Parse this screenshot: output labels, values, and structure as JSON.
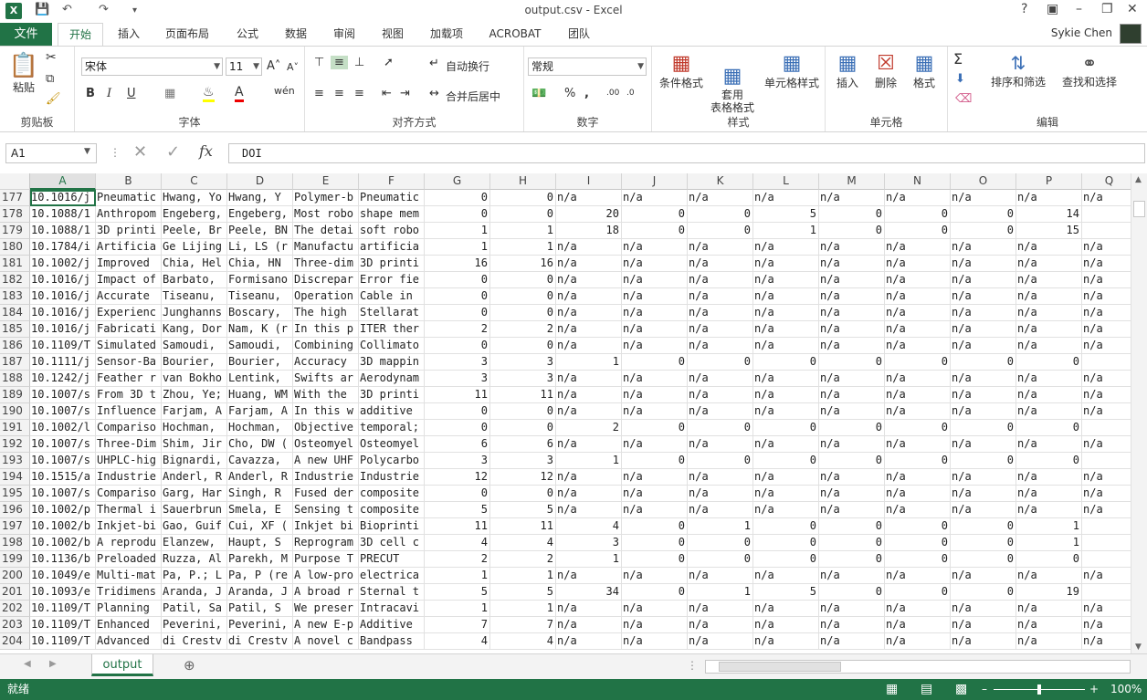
{
  "window": {
    "title": "output.csv - Excel",
    "app_icon": "X"
  },
  "tabs": {
    "file": "文件",
    "items": [
      "开始",
      "插入",
      "页面布局",
      "公式",
      "数据",
      "审阅",
      "视图",
      "加载项",
      "ACROBAT",
      "团队"
    ],
    "active": "开始",
    "user": "Sykie Chen"
  },
  "ribbon": {
    "clipboard": {
      "label": "剪贴板",
      "paste": "粘贴"
    },
    "font": {
      "label": "字体",
      "family": "宋体",
      "size": "11",
      "bold": "B",
      "italic": "I",
      "underline": "U"
    },
    "alignment": {
      "label": "对齐方式",
      "wrap": "自动换行",
      "merge": "合并后居中"
    },
    "number": {
      "label": "数字",
      "format": "常规",
      "percent": "%",
      "comma": ","
    },
    "styles": {
      "label": "样式",
      "conditional": "条件格式",
      "table": "套用\n表格格式",
      "cell": "单元格样式"
    },
    "cells": {
      "label": "单元格",
      "insert": "插入",
      "delete": "删除",
      "format": "格式"
    },
    "editing": {
      "label": "编辑",
      "sort": "排序和筛选",
      "find": "查找和选择"
    }
  },
  "formula_bar": {
    "name_box": "A1",
    "formula": "DOI",
    "fx": "fx"
  },
  "sheet": {
    "columns": [
      "A",
      "B",
      "C",
      "D",
      "E",
      "F",
      "G",
      "H",
      "I",
      "J",
      "K",
      "L",
      "M",
      "N",
      "O",
      "P",
      "Q"
    ],
    "selected_col": "A",
    "rows": [
      {
        "n": "177",
        "c": [
          "10.1016/j",
          "Pneumatic",
          "Hwang, Yo",
          "Hwang, Y",
          "Polymer-b",
          "Pneumatic",
          "0",
          "0",
          "n/a",
          "n/a",
          "n/a",
          "n/a",
          "n/a",
          "n/a",
          "n/a",
          "n/a",
          "n/a"
        ]
      },
      {
        "n": "178",
        "c": [
          "10.1088/1",
          "Anthropom",
          "Engeberg,",
          "Engeberg,",
          "Most robo",
          "shape mem",
          "0",
          "0",
          "20",
          "0",
          "0",
          "5",
          "0",
          "0",
          "0",
          "14",
          ""
        ]
      },
      {
        "n": "179",
        "c": [
          "10.1088/1",
          "3D printi",
          "Peele, Br",
          "Peele, BN",
          "The detai",
          "soft robo",
          "1",
          "1",
          "18",
          "0",
          "0",
          "1",
          "0",
          "0",
          "0",
          "15",
          ""
        ]
      },
      {
        "n": "180",
        "c": [
          "10.1784/i",
          "Artificia",
          "Ge Lijing",
          "Li, LS (r",
          "Manufactu",
          "artificia",
          "1",
          "1",
          "n/a",
          "n/a",
          "n/a",
          "n/a",
          "n/a",
          "n/a",
          "n/a",
          "n/a",
          "n/a"
        ]
      },
      {
        "n": "181",
        "c": [
          "10.1002/j",
          "Improved",
          "Chia, Hel",
          "Chia, HN",
          "Three-dim",
          "3D printi",
          "16",
          "16",
          "n/a",
          "n/a",
          "n/a",
          "n/a",
          "n/a",
          "n/a",
          "n/a",
          "n/a",
          "n/a"
        ]
      },
      {
        "n": "182",
        "c": [
          "10.1016/j",
          "Impact of",
          "Barbato,",
          "Formisano",
          "Discrepar",
          "Error fie",
          "0",
          "0",
          "n/a",
          "n/a",
          "n/a",
          "n/a",
          "n/a",
          "n/a",
          "n/a",
          "n/a",
          "n/a"
        ]
      },
      {
        "n": "183",
        "c": [
          "10.1016/j",
          "Accurate",
          "Tiseanu,",
          "Tiseanu,",
          "Operation",
          "Cable in",
          "0",
          "0",
          "n/a",
          "n/a",
          "n/a",
          "n/a",
          "n/a",
          "n/a",
          "n/a",
          "n/a",
          "n/a"
        ]
      },
      {
        "n": "184",
        "c": [
          "10.1016/j",
          "Experienc",
          "Junghanns",
          "Boscary,",
          "The high",
          "Stellarat",
          "0",
          "0",
          "n/a",
          "n/a",
          "n/a",
          "n/a",
          "n/a",
          "n/a",
          "n/a",
          "n/a",
          "n/a"
        ]
      },
      {
        "n": "185",
        "c": [
          "10.1016/j",
          "Fabricati",
          "Kang, Dor",
          "Nam, K (r",
          "In this p",
          "ITER ther",
          "2",
          "2",
          "n/a",
          "n/a",
          "n/a",
          "n/a",
          "n/a",
          "n/a",
          "n/a",
          "n/a",
          "n/a"
        ]
      },
      {
        "n": "186",
        "c": [
          "10.1109/T",
          "Simulated",
          "Samoudi,",
          "Samoudi,",
          "Combining",
          "Collimato",
          "0",
          "0",
          "n/a",
          "n/a",
          "n/a",
          "n/a",
          "n/a",
          "n/a",
          "n/a",
          "n/a",
          "n/a"
        ]
      },
      {
        "n": "187",
        "c": [
          "10.1111/j",
          "Sensor-Ba",
          "Bourier,",
          "Bourier,",
          "Accuracy",
          "3D mappin",
          "3",
          "3",
          "1",
          "0",
          "0",
          "0",
          "0",
          "0",
          "0",
          "0",
          ""
        ]
      },
      {
        "n": "188",
        "c": [
          "10.1242/j",
          "Feather r",
          "van Bokho",
          "Lentink,",
          "Swifts ar",
          "Aerodynam",
          "3",
          "3",
          "n/a",
          "n/a",
          "n/a",
          "n/a",
          "n/a",
          "n/a",
          "n/a",
          "n/a",
          "n/a"
        ]
      },
      {
        "n": "189",
        "c": [
          "10.1007/s",
          "From 3D t",
          "Zhou, Ye;",
          "Huang, WM",
          "With the",
          "3D printi",
          "11",
          "11",
          "n/a",
          "n/a",
          "n/a",
          "n/a",
          "n/a",
          "n/a",
          "n/a",
          "n/a",
          "n/a"
        ]
      },
      {
        "n": "190",
        "c": [
          "10.1007/s",
          "Influence",
          "Farjam, A",
          "Farjam, A",
          "In this w",
          "additive",
          "0",
          "0",
          "n/a",
          "n/a",
          "n/a",
          "n/a",
          "n/a",
          "n/a",
          "n/a",
          "n/a",
          "n/a"
        ]
      },
      {
        "n": "191",
        "c": [
          "10.1002/l",
          "Compariso",
          "Hochman,",
          "Hochman,",
          "Objective",
          "temporal;",
          "0",
          "0",
          "2",
          "0",
          "0",
          "0",
          "0",
          "0",
          "0",
          "0",
          ""
        ]
      },
      {
        "n": "192",
        "c": [
          "10.1007/s",
          "Three-Dim",
          "Shim, Jir",
          "Cho, DW (",
          "Osteomyel",
          "Osteomyel",
          "6",
          "6",
          "n/a",
          "n/a",
          "n/a",
          "n/a",
          "n/a",
          "n/a",
          "n/a",
          "n/a",
          "n/a"
        ]
      },
      {
        "n": "193",
        "c": [
          "10.1007/s",
          "UHPLC-hig",
          "Bignardi,",
          "Cavazza,",
          "A new UHF",
          "Polycarbo",
          "3",
          "3",
          "1",
          "0",
          "0",
          "0",
          "0",
          "0",
          "0",
          "0",
          ""
        ]
      },
      {
        "n": "194",
        "c": [
          "10.1515/a",
          "Industrie",
          "Anderl, R",
          "Anderl, R",
          "Industrie",
          "Industrie",
          "12",
          "12",
          "n/a",
          "n/a",
          "n/a",
          "n/a",
          "n/a",
          "n/a",
          "n/a",
          "n/a",
          "n/a"
        ]
      },
      {
        "n": "195",
        "c": [
          "10.1007/s",
          "Compariso",
          "Garg, Har",
          "Singh, R",
          "Fused der",
          "composite",
          "0",
          "0",
          "n/a",
          "n/a",
          "n/a",
          "n/a",
          "n/a",
          "n/a",
          "n/a",
          "n/a",
          "n/a"
        ]
      },
      {
        "n": "196",
        "c": [
          "10.1002/p",
          "Thermal i",
          "Sauerbrun",
          "Smela, E",
          "Sensing t",
          "composite",
          "5",
          "5",
          "n/a",
          "n/a",
          "n/a",
          "n/a",
          "n/a",
          "n/a",
          "n/a",
          "n/a",
          "n/a"
        ]
      },
      {
        "n": "197",
        "c": [
          "10.1002/b",
          "Inkjet-bi",
          "Gao, Guif",
          "Cui, XF (",
          "Inkjet bi",
          "Bioprinti",
          "11",
          "11",
          "4",
          "0",
          "1",
          "0",
          "0",
          "0",
          "0",
          "1",
          ""
        ]
      },
      {
        "n": "198",
        "c": [
          "10.1002/b",
          "A reprodu",
          "Elanzew,",
          "Haupt, S",
          "Reprogram",
          "3D cell c",
          "4",
          "4",
          "3",
          "0",
          "0",
          "0",
          "0",
          "0",
          "0",
          "1",
          ""
        ]
      },
      {
        "n": "199",
        "c": [
          "10.1136/b",
          "Preloaded",
          "Ruzza, Al",
          "Parekh, M",
          "Purpose T",
          "PRECUT",
          "2",
          "2",
          "1",
          "0",
          "0",
          "0",
          "0",
          "0",
          "0",
          "0",
          ""
        ]
      },
      {
        "n": "200",
        "c": [
          "10.1049/e",
          "Multi-mat",
          "Pa, P.; L",
          "Pa, P (re",
          "A low-pro",
          "electrica",
          "1",
          "1",
          "n/a",
          "n/a",
          "n/a",
          "n/a",
          "n/a",
          "n/a",
          "n/a",
          "n/a",
          "n/a"
        ]
      },
      {
        "n": "201",
        "c": [
          "10.1093/e",
          "Tridimens",
          "Aranda, J",
          "Aranda, J",
          "A broad r",
          "Sternal t",
          "5",
          "5",
          "34",
          "0",
          "1",
          "5",
          "0",
          "0",
          "0",
          "19",
          ""
        ]
      },
      {
        "n": "202",
        "c": [
          "10.1109/T",
          "Planning",
          "Patil, Sa",
          "Patil, S",
          "We preser",
          "Intracavi",
          "1",
          "1",
          "n/a",
          "n/a",
          "n/a",
          "n/a",
          "n/a",
          "n/a",
          "n/a",
          "n/a",
          "n/a"
        ]
      },
      {
        "n": "203",
        "c": [
          "10.1109/T",
          "Enhanced",
          "Peverini,",
          "Peverini,",
          "A new E-p",
          "Additive",
          "7",
          "7",
          "n/a",
          "n/a",
          "n/a",
          "n/a",
          "n/a",
          "n/a",
          "n/a",
          "n/a",
          "n/a"
        ]
      },
      {
        "n": "204",
        "c": [
          "10.1109/T",
          "Advanced",
          "di Crestv",
          "di Crestv",
          "A novel c",
          "Bandpass",
          "4",
          "4",
          "n/a",
          "n/a",
          "n/a",
          "n/a",
          "n/a",
          "n/a",
          "n/a",
          "n/a",
          "n/a"
        ]
      }
    ]
  },
  "sheet_tab": "output",
  "status": {
    "ready": "就绪",
    "zoom": "100%"
  }
}
